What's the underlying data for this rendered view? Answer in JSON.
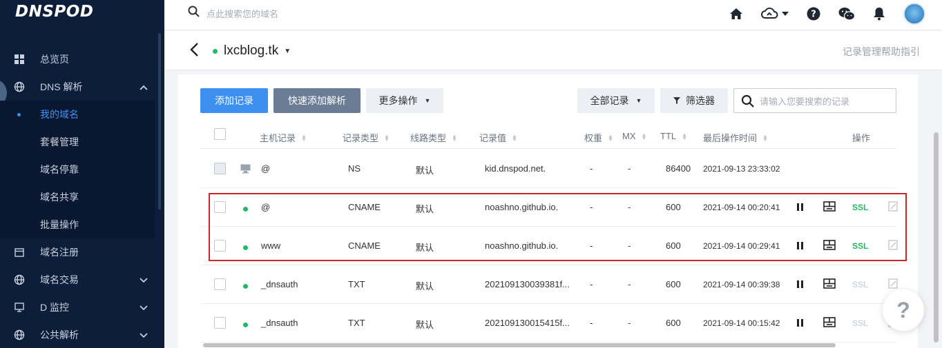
{
  "app": {
    "logo": "DNSPOD"
  },
  "topbar": {
    "search_placeholder": "点此搜索您的域名"
  },
  "sidebar": {
    "items": [
      {
        "label": "总览页",
        "icon": "grid-icon"
      },
      {
        "label": "DNS 解析",
        "icon": "globe-icon",
        "expanded": true
      },
      {
        "label": "我的域名",
        "sub": true,
        "active": true
      },
      {
        "label": "套餐管理",
        "sub": true
      },
      {
        "label": "域名停靠",
        "sub": true
      },
      {
        "label": "域名共享",
        "sub": true
      },
      {
        "label": "批量操作",
        "sub": true
      },
      {
        "label": "域名注册",
        "icon": "calendar-icon"
      },
      {
        "label": "域名交易",
        "icon": "globe-icon"
      },
      {
        "label": "D 监控",
        "icon": "monitor-icon"
      },
      {
        "label": "公共解析",
        "icon": "globe-icon"
      }
    ]
  },
  "domain": {
    "name": "lxcblog.tk",
    "help_link": "记录管理帮助指引"
  },
  "toolbar": {
    "add_record": "添加记录",
    "quick_add": "快速添加解析",
    "more_actions": "更多操作",
    "all_records": "全部记录",
    "filter": "筛选器",
    "search_placeholder": "请输入您要搜索的记录"
  },
  "table": {
    "headers": {
      "host": "主机记录",
      "type": "记录类型",
      "line": "线路类型",
      "value": "记录值",
      "weight": "权重",
      "mx": "MX",
      "ttl": "TTL",
      "updated": "最后操作时间",
      "actions": "操作"
    },
    "rows": [
      {
        "host": "@",
        "type": "NS",
        "line": "默认",
        "value": "kid.dnspod.net.",
        "weight": "-",
        "mx": "-",
        "ttl": "86400",
        "updated": "2021-09-13 23:33:02"
      },
      {
        "host": "@",
        "type": "CNAME",
        "line": "默认",
        "value": "noashno.github.io.",
        "weight": "-",
        "mx": "-",
        "ttl": "600",
        "updated": "2021-09-14 00:20:41",
        "ssl": "SSL"
      },
      {
        "host": "www",
        "type": "CNAME",
        "line": "默认",
        "value": "noashno.github.io.",
        "weight": "-",
        "mx": "-",
        "ttl": "600",
        "updated": "2021-09-14 00:29:41",
        "ssl": "SSL"
      },
      {
        "host": "_dnsauth",
        "type": "TXT",
        "line": "默认",
        "value": "202109130039381f...",
        "weight": "-",
        "mx": "-",
        "ttl": "600",
        "updated": "2021-09-14 00:39:38",
        "ssl": "SSL"
      },
      {
        "host": "_dnsauth",
        "type": "TXT",
        "line": "默认",
        "value": "202109130015415f...",
        "weight": "-",
        "mx": "-",
        "ttl": "600",
        "updated": "2021-09-14 00:15:42",
        "ssl": "SSL"
      }
    ]
  },
  "help_float": "?",
  "colors": {
    "primary": "#3d8ff0",
    "sidebar": "#0d1e3b",
    "enabled": "#25b864",
    "highlight": "#c8262c"
  }
}
